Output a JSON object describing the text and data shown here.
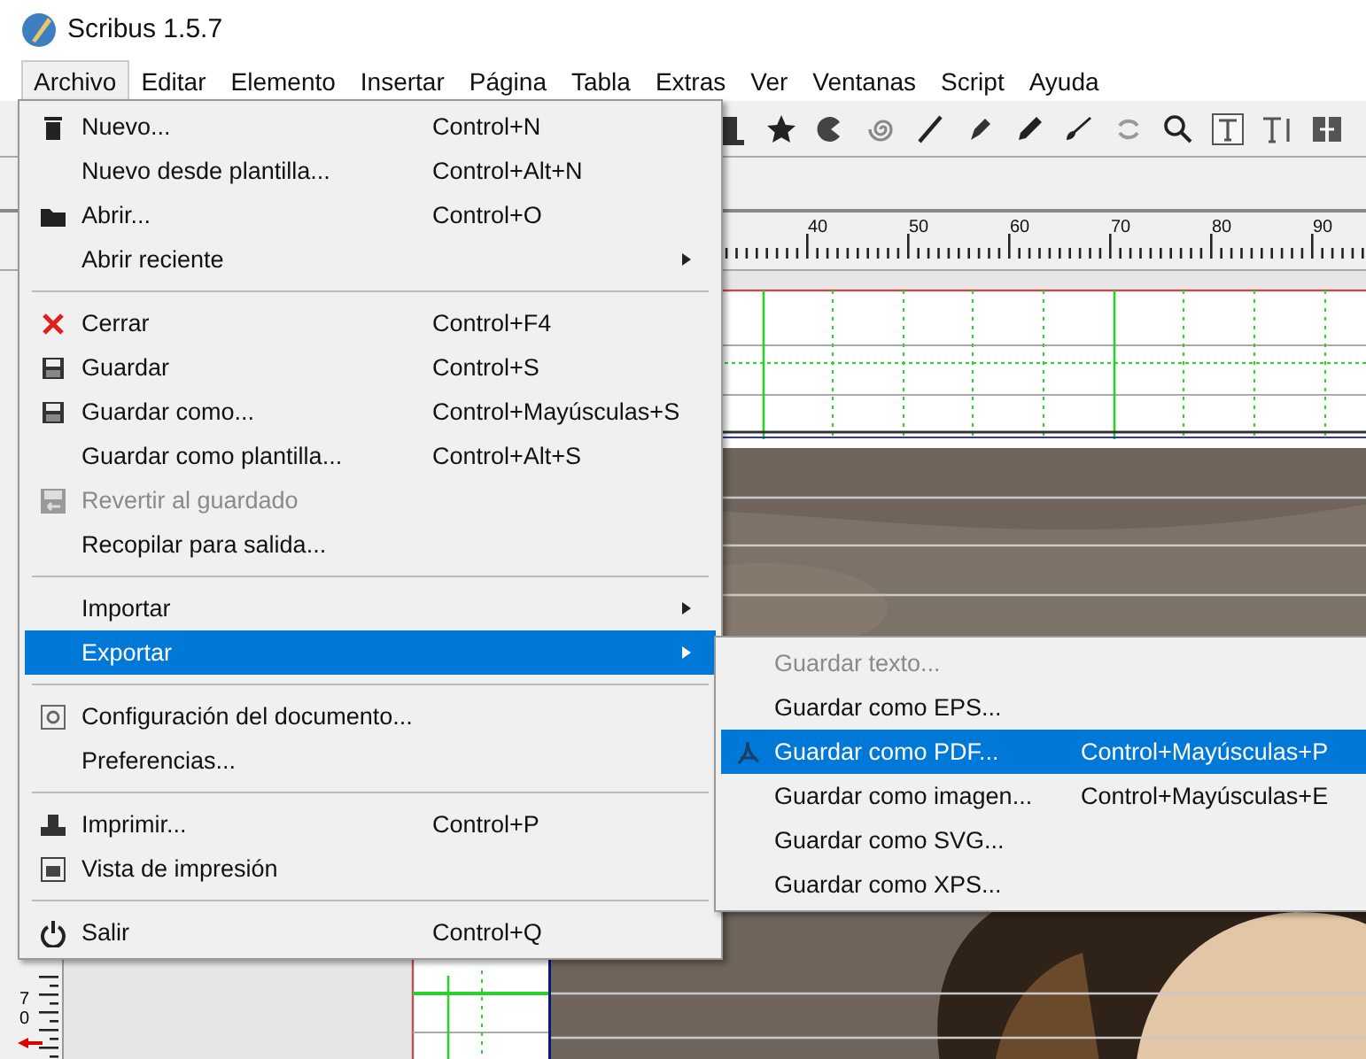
{
  "window": {
    "title": "Scribus 1.5.7"
  },
  "menubar": [
    {
      "label": "Archivo",
      "selected": true
    },
    {
      "label": "Editar",
      "selected": false
    },
    {
      "label": "Elemento",
      "selected": false
    },
    {
      "label": "Insertar",
      "selected": false
    },
    {
      "label": "Página",
      "selected": false
    },
    {
      "label": "Tabla",
      "selected": false
    },
    {
      "label": "Extras",
      "selected": false
    },
    {
      "label": "Ver",
      "selected": false
    },
    {
      "label": "Ventanas",
      "selected": false
    },
    {
      "label": "Script",
      "selected": false
    },
    {
      "label": "Ayuda",
      "selected": false
    }
  ],
  "file_menu": {
    "groups": [
      [
        {
          "label": "Nuevo...",
          "shortcut": "Control+N",
          "disabled": false,
          "selected": false,
          "submenu": false
        },
        {
          "label": "Nuevo desde plantilla...",
          "shortcut": "Control+Alt+N",
          "disabled": false,
          "selected": false,
          "submenu": false
        },
        {
          "label": "Abrir...",
          "shortcut": "Control+O",
          "disabled": false,
          "selected": false,
          "submenu": false
        },
        {
          "label": "Abrir reciente",
          "disabled": false,
          "selected": false,
          "submenu": true
        }
      ],
      [
        {
          "label": "Cerrar",
          "shortcut": "Control+F4",
          "disabled": false,
          "selected": false,
          "submenu": false
        },
        {
          "label": "Guardar",
          "shortcut": "Control+S",
          "disabled": false,
          "selected": false,
          "submenu": false
        },
        {
          "label": "Guardar como...",
          "shortcut": "Control+Mayúsculas+S",
          "disabled": false,
          "selected": false,
          "submenu": false
        },
        {
          "label": "Guardar como plantilla...",
          "shortcut": "Control+Alt+S",
          "disabled": false,
          "selected": false,
          "submenu": false
        },
        {
          "label": "Revertir al guardado",
          "disabled": true,
          "selected": false,
          "submenu": false
        },
        {
          "label": "Recopilar para salida...",
          "disabled": false,
          "selected": false,
          "submenu": false
        }
      ],
      [
        {
          "label": "Importar",
          "disabled": false,
          "selected": false,
          "submenu": true
        },
        {
          "label": "Exportar",
          "disabled": false,
          "selected": true,
          "submenu": true
        }
      ],
      [
        {
          "label": "Configuración del documento...",
          "disabled": false,
          "selected": false,
          "submenu": false
        },
        {
          "label": "Preferencias...",
          "disabled": false,
          "selected": false,
          "submenu": false
        }
      ],
      [
        {
          "label": "Imprimir...",
          "shortcut": "Control+P",
          "disabled": false,
          "selected": false,
          "submenu": false
        },
        {
          "label": "Vista de impresión",
          "disabled": false,
          "selected": false,
          "submenu": false
        }
      ],
      [
        {
          "label": "Salir",
          "shortcut": "Control+Q",
          "disabled": false,
          "selected": false,
          "submenu": false
        }
      ]
    ]
  },
  "export_submenu": {
    "groups": [
      [
        {
          "label": "Guardar texto...",
          "disabled": true,
          "selected": false,
          "submenu": false
        },
        {
          "label": "Guardar como EPS...",
          "disabled": false,
          "selected": false,
          "submenu": false
        },
        {
          "label": "Guardar como PDF...",
          "shortcut": "Control+Mayúsculas+P",
          "disabled": false,
          "selected": true,
          "submenu": false
        },
        {
          "label": "Guardar como imagen...",
          "shortcut": "Control+Mayúsculas+E",
          "disabled": false,
          "selected": false,
          "submenu": false
        },
        {
          "label": "Guardar como SVG...",
          "disabled": false,
          "selected": false,
          "submenu": false
        },
        {
          "label": "Guardar como XPS...",
          "disabled": false,
          "selected": false,
          "submenu": false
        }
      ]
    ]
  },
  "ruler": {
    "labels": [
      "40",
      "50",
      "60",
      "70",
      "80",
      "90"
    ]
  },
  "vertical_ruler": {
    "label": "70"
  }
}
